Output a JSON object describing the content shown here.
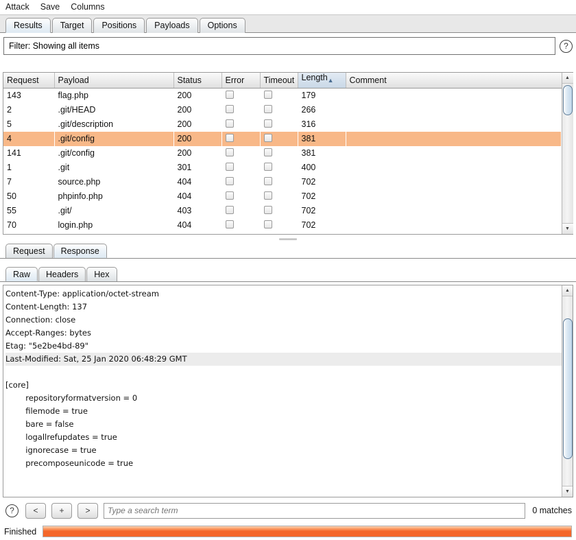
{
  "menubar": {
    "items": [
      {
        "label": "Attack"
      },
      {
        "label": "Save"
      },
      {
        "label": "Columns"
      }
    ]
  },
  "tabs": [
    {
      "label": "Results",
      "active": true
    },
    {
      "label": "Target",
      "active": false
    },
    {
      "label": "Positions",
      "active": false
    },
    {
      "label": "Payloads",
      "active": false
    },
    {
      "label": "Options",
      "active": false
    }
  ],
  "filter": {
    "text": "Filter: Showing all items",
    "help_icon": "question-mark-icon",
    "help_label": "?"
  },
  "table": {
    "columns": [
      {
        "label": "Request",
        "sorted": false
      },
      {
        "label": "Payload",
        "sorted": false
      },
      {
        "label": "Status",
        "sorted": false
      },
      {
        "label": "Error",
        "sorted": false
      },
      {
        "label": "Timeout",
        "sorted": false
      },
      {
        "label": "Length",
        "sorted": true,
        "sort_arrow": "▲"
      },
      {
        "label": "Comment",
        "sorted": false
      }
    ],
    "rows": [
      {
        "request": "143",
        "payload": "flag.php",
        "status": "200",
        "error": false,
        "timeout": false,
        "length": "179",
        "comment": "",
        "selected": false
      },
      {
        "request": "2",
        "payload": ".git/HEAD",
        "status": "200",
        "error": false,
        "timeout": false,
        "length": "266",
        "comment": "",
        "selected": false
      },
      {
        "request": "5",
        "payload": ".git/description",
        "status": "200",
        "error": false,
        "timeout": false,
        "length": "316",
        "comment": "",
        "selected": false
      },
      {
        "request": "4",
        "payload": ".git/config",
        "status": "200",
        "error": false,
        "timeout": false,
        "length": "381",
        "comment": "",
        "selected": true
      },
      {
        "request": "141",
        "payload": ".git/config",
        "status": "200",
        "error": false,
        "timeout": false,
        "length": "381",
        "comment": "",
        "selected": false
      },
      {
        "request": "1",
        "payload": ".git",
        "status": "301",
        "error": false,
        "timeout": false,
        "length": "400",
        "comment": "",
        "selected": false
      },
      {
        "request": "7",
        "payload": "source.php",
        "status": "404",
        "error": false,
        "timeout": false,
        "length": "702",
        "comment": "",
        "selected": false
      },
      {
        "request": "50",
        "payload": "phpinfo.php",
        "status": "404",
        "error": false,
        "timeout": false,
        "length": "702",
        "comment": "",
        "selected": false
      },
      {
        "request": "55",
        "payload": ".git/",
        "status": "403",
        "error": false,
        "timeout": false,
        "length": "702",
        "comment": "",
        "selected": false
      },
      {
        "request": "70",
        "payload": "login.php",
        "status": "404",
        "error": false,
        "timeout": false,
        "length": "702",
        "comment": "",
        "selected": false
      }
    ]
  },
  "message_tabs": [
    {
      "label": "Request",
      "active": false
    },
    {
      "label": "Response",
      "active": true
    }
  ],
  "view_tabs": [
    {
      "label": "Raw",
      "active": true
    },
    {
      "label": "Headers",
      "active": false
    },
    {
      "label": "Hex",
      "active": false
    }
  ],
  "response": {
    "lines": [
      {
        "text": "Content-Type: application/octet-stream",
        "highlight": false
      },
      {
        "text": "Content-Length: 137",
        "highlight": false
      },
      {
        "text": "Connection: close",
        "highlight": false
      },
      {
        "text": "Accept-Ranges: bytes",
        "highlight": false
      },
      {
        "text": "Etag: \"5e2be4bd-89\"",
        "highlight": false
      },
      {
        "text": "Last-Modified: Sat, 25 Jan 2020 06:48:29 GMT",
        "highlight": true
      },
      {
        "text": "",
        "highlight": false
      },
      {
        "text": "[core]",
        "highlight": false
      },
      {
        "text": "        repositoryformatversion = 0",
        "highlight": false
      },
      {
        "text": "        filemode = true",
        "highlight": false
      },
      {
        "text": "        bare = false",
        "highlight": false
      },
      {
        "text": "        logallrefupdates = true",
        "highlight": false
      },
      {
        "text": "        ignorecase = true",
        "highlight": false
      },
      {
        "text": "        precomposeunicode = true",
        "highlight": false
      }
    ]
  },
  "search": {
    "help_label": "?",
    "prev_label": "<",
    "add_label": "+",
    "next_label": ">",
    "placeholder": "Type a search term",
    "value": "",
    "matches": "0 matches"
  },
  "status": {
    "label": "Finished",
    "progress_percent": 100,
    "progress_color": "#f4672a"
  },
  "colors": {
    "selected_row": "#f8b888",
    "sorted_header": "#d5e1ed",
    "scroll_thumb": "#c2d8ea"
  }
}
